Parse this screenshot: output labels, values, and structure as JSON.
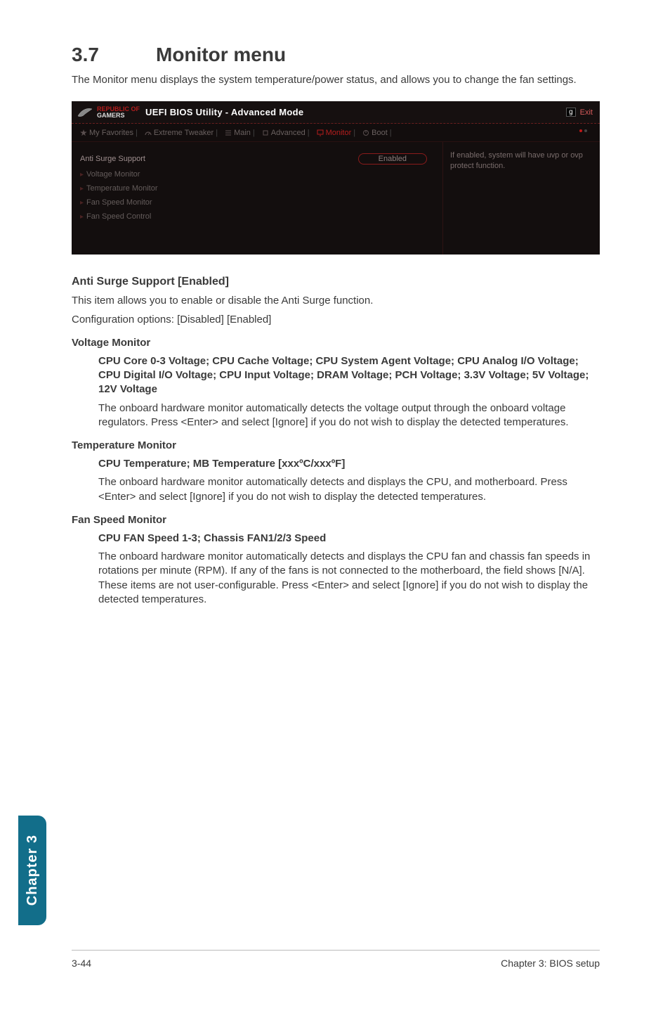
{
  "section": {
    "number": "3.7",
    "title": "Monitor menu",
    "intro": "The Monitor menu displays the system temperature/power status, and allows you to change the fan settings."
  },
  "bios": {
    "brand_top": "REPUBLIC OF",
    "brand_bottom": "GAMERS",
    "title": "UEFI BIOS Utility - Advanced Mode",
    "exit": "Exit",
    "tabs": {
      "favorites": "My Favorites",
      "tweaker": "Extreme Tweaker",
      "main": "Main",
      "advanced": "Advanced",
      "monitor": "Monitor",
      "boot": "Boot"
    },
    "rows": {
      "anti_surge": "Anti Surge Support",
      "anti_surge_value": "Enabled",
      "voltage": "Voltage Monitor",
      "temperature": "Temperature Monitor",
      "fan_speed_monitor": "Fan Speed Monitor",
      "fan_speed_control": "Fan Speed Control"
    },
    "help": "If enabled, system will have uvp or ovp protect function."
  },
  "anti_surge": {
    "heading": "Anti Surge Support [Enabled]",
    "desc": "This item allows you to enable or disable the Anti Surge function.",
    "config": "Configuration options: [Disabled] [Enabled]"
  },
  "voltage": {
    "heading": "Voltage Monitor",
    "sub": "CPU Core 0-3 Voltage; CPU Cache Voltage; CPU System Agent Voltage; CPU Analog I/O Voltage; CPU Digital I/O Voltage; CPU Input Voltage; DRAM Voltage; PCH Voltage; 3.3V Voltage; 5V Voltage; 12V Voltage",
    "desc": "The onboard hardware monitor automatically detects the voltage output through the onboard voltage regulators. Press <Enter> and select [Ignore] if you do not wish to display the detected temperatures."
  },
  "temperature": {
    "heading": "Temperature Monitor",
    "sub": "CPU Temperature; MB Temperature [xxxºC/xxxºF]",
    "desc": "The onboard hardware monitor automatically detects and displays the CPU, and motherboard. Press <Enter> and select [Ignore] if you do not wish to display the detected temperatures."
  },
  "fan": {
    "heading": "Fan Speed Monitor",
    "sub": "CPU FAN Speed 1-3; Chassis FAN1/2/3 Speed",
    "desc": "The onboard hardware monitor automatically detects and displays the CPU fan and chassis fan speeds in rotations per minute (RPM). If any of the fans is not connected to the motherboard, the field shows [N/A]. These items are not user-configurable. Press <Enter> and select [Ignore] if you do not wish to display the detected temperatures."
  },
  "side_tab": "Chapter 3",
  "footer": {
    "left": "3-44",
    "right": "Chapter 3: BIOS setup"
  }
}
